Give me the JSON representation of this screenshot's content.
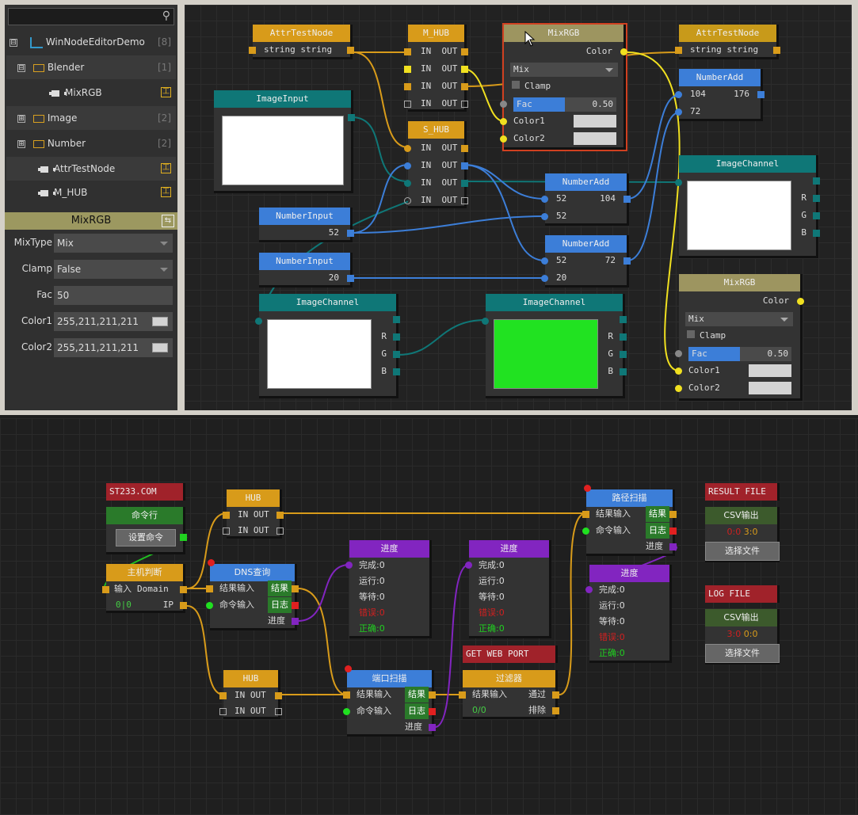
{
  "tree": {
    "search_placeholder": "",
    "items": [
      {
        "toggle": "⊟",
        "label": "WinNodeEditorDemo",
        "count": "[8]"
      },
      {
        "toggle": "⊟",
        "label": "Blender",
        "count": "[1]"
      },
      {
        "toggle": "",
        "label": "MixRGB",
        "count": ""
      },
      {
        "toggle": "⊞",
        "label": "Image",
        "count": "[2]"
      },
      {
        "toggle": "⊞",
        "label": "Number",
        "count": "[2]"
      },
      {
        "toggle": "",
        "label": "AttrTestNode",
        "count": ""
      },
      {
        "toggle": "",
        "label": "M_HUB",
        "count": ""
      }
    ]
  },
  "props": {
    "title": "MixRGB",
    "rows": [
      {
        "label": "MixType",
        "value": "Mix"
      },
      {
        "label": "Clamp",
        "value": "False"
      },
      {
        "label": "Fac",
        "value": "50"
      },
      {
        "label": "Color1",
        "value": "255,211,211,211"
      },
      {
        "label": "Color2",
        "value": "255,211,211,211"
      }
    ]
  },
  "n1": {
    "attr1": {
      "title": "AttrTestNode",
      "row": "string string"
    },
    "attr2": {
      "title": "AttrTestNode",
      "row": "string string"
    },
    "mhub": {
      "title": "M_HUB",
      "in": "IN",
      "out": "OUT"
    },
    "shub": {
      "title": "S_HUB",
      "in": "IN",
      "out": "OUT"
    },
    "mix1": {
      "title": "MixRGB",
      "color": "Color",
      "mix": "Mix",
      "clamp": "Clamp",
      "fac": "Fac",
      "fac_val": "0.50",
      "c1": "Color1",
      "c2": "Color2"
    },
    "mix2": {
      "title": "MixRGB",
      "color": "Color",
      "mix": "Mix",
      "clamp": "Clamp",
      "fac": "Fac",
      "fac_val": "0.50",
      "c1": "Color1",
      "c2": "Color2"
    },
    "imgin": {
      "title": "ImageInput"
    },
    "ich1": {
      "title": "ImageChannel",
      "r": "R",
      "g": "G",
      "b": "B"
    },
    "ich2": {
      "title": "ImageChannel",
      "r": "R",
      "g": "G",
      "b": "B"
    },
    "ich3": {
      "title": "ImageChannel",
      "r": "R",
      "g": "G",
      "b": "B"
    },
    "num1": {
      "title": "NumberInput",
      "val": "52"
    },
    "num2": {
      "title": "NumberInput",
      "val": "20"
    },
    "add1": {
      "title": "NumberAdd",
      "a": "104",
      "res": "176",
      "b": "72"
    },
    "add2": {
      "title": "NumberAdd",
      "a": "52",
      "res": "104",
      "b": "52"
    },
    "add3": {
      "title": "NumberAdd",
      "a": "52",
      "res": "72",
      "b": "20"
    }
  },
  "n2": {
    "st": "ST233.COM",
    "cmd": {
      "title": "命令行",
      "btn": "设置命令"
    },
    "host": {
      "title": "主机判断",
      "in": "输入",
      "domain": "Domain",
      "count": "0|0",
      "ip": "IP"
    },
    "hub1": {
      "title": "HUB",
      "in": "IN",
      "out": "OUT"
    },
    "hub2": {
      "title": "HUB",
      "in": "IN",
      "out": "OUT"
    },
    "dns": {
      "title": "DNS查询",
      "in": "结果输入",
      "res": "结果",
      "cmd": "命令输入",
      "log": "日志",
      "prog": "进度"
    },
    "port": {
      "title": "端口扫描",
      "in": "结果输入",
      "res": "结果",
      "cmd": "命令输入",
      "log": "日志",
      "prog": "进度"
    },
    "path": {
      "title": "路径扫描",
      "in": "结果输入",
      "res": "结果",
      "cmd": "命令输入",
      "log": "日志",
      "prog": "进度"
    },
    "p1": {
      "title": "进度",
      "done": "完成:0",
      "run": "运行:0",
      "wait": "等待:0",
      "err": "错误:0",
      "ok": "正确:0"
    },
    "p2": {
      "title": "进度",
      "done": "完成:0",
      "run": "运行:0",
      "wait": "等待:0",
      "err": "错误:0",
      "ok": "正确:0"
    },
    "p3": {
      "title": "进度",
      "done": "完成:0",
      "run": "运行:0",
      "wait": "等待:0",
      "err": "错误:0",
      "ok": "正确:0"
    },
    "getweb": "GET WEB PORT",
    "filter": {
      "title": "过滤器",
      "in": "结果输入",
      "pass": "通过",
      "count": "0/0",
      "excl": "排除"
    },
    "result": "RESULT FILE",
    "log": "LOG FILE",
    "csv1": {
      "title": "CSV输出",
      "a": "0:0",
      "b": "3:0",
      "btn": "选择文件"
    },
    "csv2": {
      "title": "CSV输出",
      "a": "3:0",
      "b": "0:0",
      "btn": "选择文件"
    }
  },
  "colors": {
    "orange": "#d89b1a",
    "blue": "#3c7ed8",
    "teal": "#0f7777",
    "yellow": "#f0e020",
    "purple": "#8225c0"
  }
}
